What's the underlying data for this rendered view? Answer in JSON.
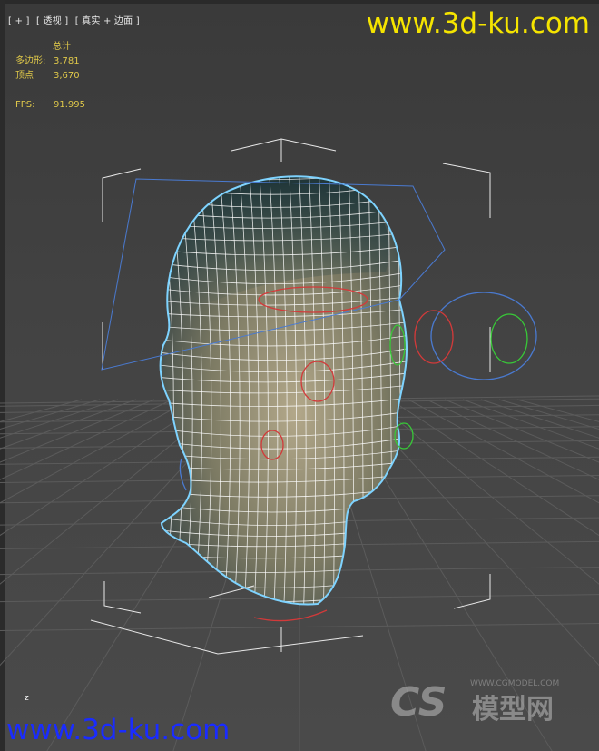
{
  "viewport": {
    "label_parts": [
      "[ + ]",
      "[ 透视 ]",
      "[ 真实 + 边面 ]"
    ]
  },
  "stats": {
    "header": "总计",
    "polygons_label": "多边形:",
    "polygons_value": "3,781",
    "vertices_label": "顶点",
    "vertices_value": "3,670",
    "fps_label": "FPS:",
    "fps_value": "91.995"
  },
  "watermark": {
    "top": "www.3d-ku.com",
    "bottom": "www.3d-ku.com",
    "logo_letters": "CS",
    "logo_text": "模型网",
    "logo_url": "WWW.CGMODEL.COM"
  },
  "axis": {
    "z_label": "z"
  },
  "colors": {
    "wire": "#ffffff",
    "selection_outline": "#7ed3ff",
    "bbox": "#e8e8e8",
    "bone_red": "#d23a3a",
    "bone_green": "#38c838",
    "bone_blue": "#4a7ad0",
    "stats_text": "#e0c94a",
    "watermark_yellow": "#f5e400",
    "watermark_blue": "#1a2cff"
  }
}
